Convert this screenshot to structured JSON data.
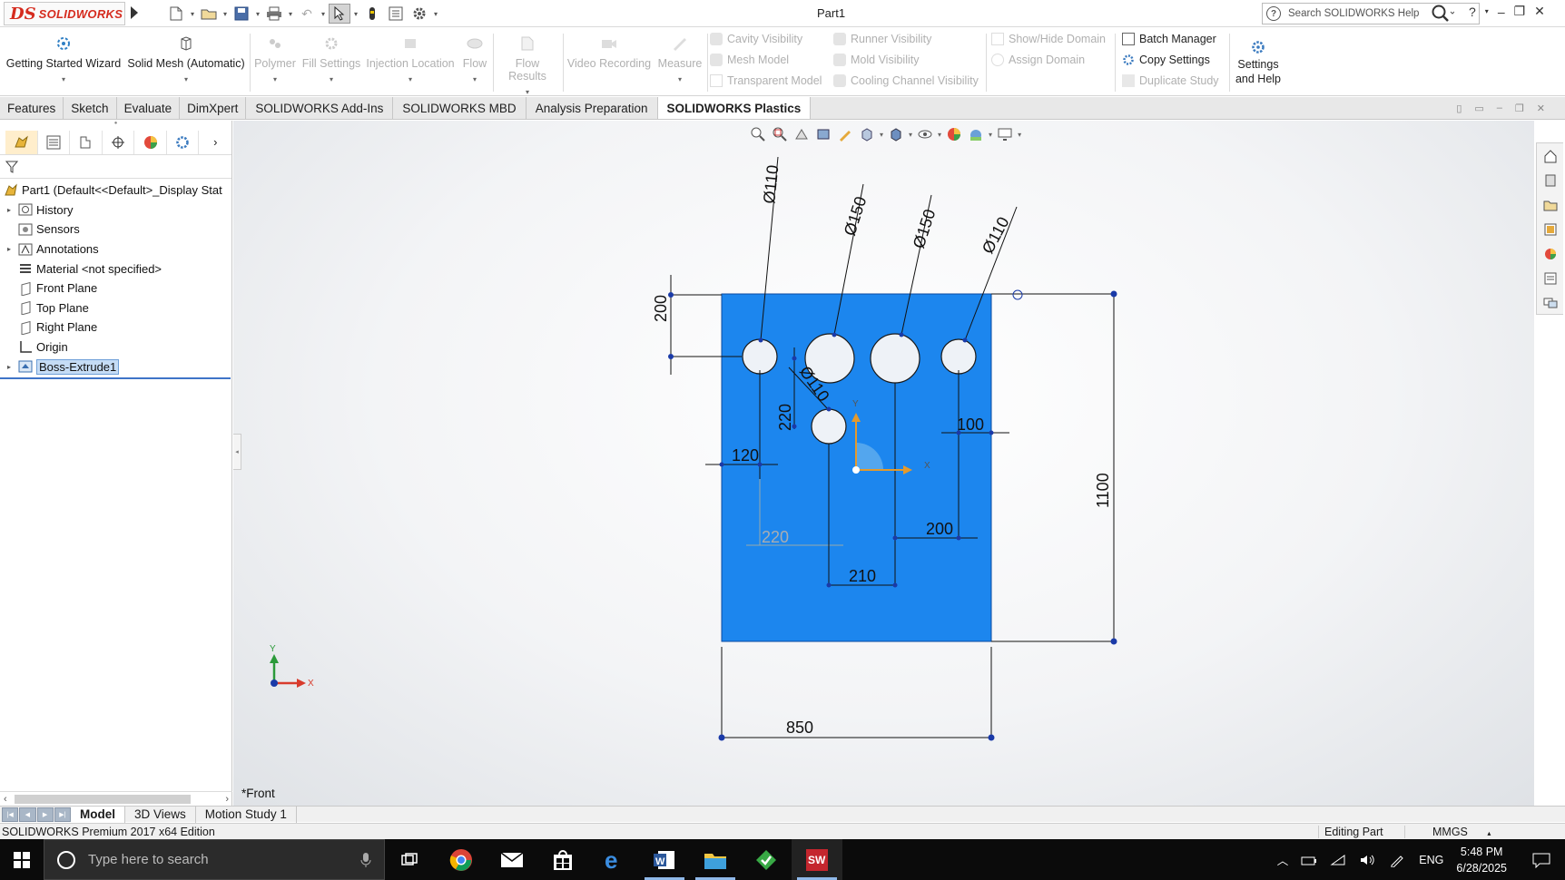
{
  "app": {
    "logo_text": "SOLIDWORKS",
    "logo_ds": "DS",
    "document_title": "Part1",
    "search_placeholder": "Search SOLIDWORKS Help"
  },
  "ribbon": {
    "big_buttons": [
      {
        "label": "Getting Started Wizard",
        "enabled": true
      },
      {
        "label": "Solid Mesh (Automatic)",
        "enabled": true
      },
      {
        "label": "Polymer",
        "enabled": false
      },
      {
        "label": "Fill Settings",
        "enabled": false
      },
      {
        "label": "Injection Location",
        "enabled": false
      },
      {
        "label": "Flow",
        "enabled": false
      },
      {
        "label": "Flow Results",
        "enabled": false
      },
      {
        "label": "Video Recording",
        "enabled": false
      },
      {
        "label": "Measure",
        "enabled": false
      }
    ],
    "small_buttons": [
      {
        "label": "Cavity Visibility",
        "enabled": false
      },
      {
        "label": "Mesh Model",
        "enabled": false
      },
      {
        "label": "Transparent Model",
        "enabled": false
      },
      {
        "label": "Runner Visibility",
        "enabled": false
      },
      {
        "label": "Mold Visibility",
        "enabled": false
      },
      {
        "label": "Cooling Channel Visibility",
        "enabled": false
      },
      {
        "label": "Show/Hide Domain",
        "enabled": false
      },
      {
        "label": "Assign Domain",
        "enabled": false
      },
      {
        "label": "Batch Manager",
        "enabled": true
      },
      {
        "label": "Copy Settings",
        "enabled": true
      },
      {
        "label": "Duplicate Study",
        "enabled": false
      }
    ],
    "settings_label_1": "Settings",
    "settings_label_2": "and Help"
  },
  "tabs": [
    "Features",
    "Sketch",
    "Evaluate",
    "DimXpert",
    "SOLIDWORKS Add-Ins",
    "SOLIDWORKS MBD",
    "Analysis Preparation",
    "SOLIDWORKS Plastics"
  ],
  "active_tab": "SOLIDWORKS Plastics",
  "feature_tree": [
    {
      "label": "Part1  (Default<<Default>_Display Stat",
      "expandable": false,
      "selected": false,
      "icon": "part-icon"
    },
    {
      "label": "History",
      "expandable": true,
      "selected": false,
      "icon": "history-icon"
    },
    {
      "label": "Sensors",
      "expandable": false,
      "selected": false,
      "icon": "sensors-icon"
    },
    {
      "label": "Annotations",
      "expandable": true,
      "selected": false,
      "icon": "annotations-icon"
    },
    {
      "label": "Material <not specified>",
      "expandable": false,
      "selected": false,
      "icon": "material-icon"
    },
    {
      "label": "Front Plane",
      "expandable": false,
      "selected": false,
      "icon": "plane-icon"
    },
    {
      "label": "Top Plane",
      "expandable": false,
      "selected": false,
      "icon": "plane-icon"
    },
    {
      "label": "Right Plane",
      "expandable": false,
      "selected": false,
      "icon": "plane-icon"
    },
    {
      "label": "Origin",
      "expandable": false,
      "selected": false,
      "icon": "origin-icon"
    },
    {
      "label": "Boss-Extrude1",
      "expandable": true,
      "selected": true,
      "icon": "extrude-icon"
    }
  ],
  "drawing": {
    "dimensions": {
      "d_hole_1": "Ø110",
      "d_hole_2": "Ø150",
      "d_hole_3": "Ø150",
      "d_hole_4": "Ø110",
      "d_hole_center": "Ø110",
      "top_offset": "200",
      "center_hole_offset": "220",
      "left_120": "120",
      "right_100": "100",
      "spacing_220": "220",
      "spacing_200": "200",
      "spacing_210": "210",
      "height": "1100",
      "width": "850"
    },
    "axis_x": "X",
    "axis_y": "Y",
    "plate_color": "#1c86ee"
  },
  "view_name": "*Front",
  "model_tabs": [
    "Model",
    "3D Views",
    "Motion Study 1"
  ],
  "active_model_tab": "Model",
  "status": {
    "edition": "SOLIDWORKS Premium 2017 x64 Edition",
    "mode": "Editing Part",
    "units": "MMGS"
  },
  "taskbar": {
    "search_placeholder": "Type here to search",
    "language": "ENG",
    "time": "5:48 PM",
    "date": "6/28/2025"
  }
}
